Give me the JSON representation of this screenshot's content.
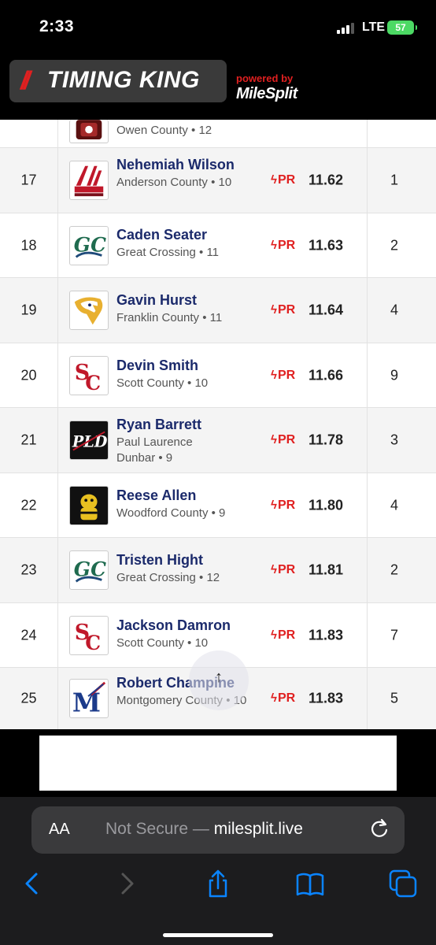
{
  "status_bar": {
    "time": "2:33",
    "network": "LTE",
    "battery": "57"
  },
  "header": {
    "logo_slashes": "//",
    "logo_text": "TIMING KING",
    "powered_by": "powered by",
    "partner": "MileSplit"
  },
  "partial_row": {
    "team_grade": "Owen County • 12"
  },
  "results": [
    {
      "place": "17",
      "name": "Nehemiah Wilson",
      "team_grade": "Anderson County • 10",
      "pr": "PR",
      "mark": "11.62",
      "heat": "1",
      "logo": "achs-track-field-logo"
    },
    {
      "place": "18",
      "name": "Caden Seater",
      "team_grade": "Great Crossing • 11",
      "pr": "PR",
      "mark": "11.63",
      "heat": "2",
      "logo": "great-crossing-logo"
    },
    {
      "place": "19",
      "name": "Gavin Hurst",
      "team_grade": "Franklin County • 11",
      "pr": "PR",
      "mark": "11.64",
      "heat": "4",
      "logo": "franklin-county-eagle-logo"
    },
    {
      "place": "20",
      "name": "Devin Smith",
      "team_grade": "Scott County • 10",
      "pr": "PR",
      "mark": "11.66",
      "heat": "9",
      "logo": "scott-county-logo"
    },
    {
      "place": "21",
      "name": "Ryan Barrett",
      "team_grade": "Paul Laurence Dunbar • 9",
      "pr": "PR",
      "mark": "11.78",
      "heat": "3",
      "logo": "pld-logo"
    },
    {
      "place": "22",
      "name": "Reese Allen",
      "team_grade": "Woodford County • 9",
      "pr": "PR",
      "mark": "11.80",
      "heat": "4",
      "logo": "woodford-county-jacket-logo"
    },
    {
      "place": "23",
      "name": "Tristen Hight",
      "team_grade": "Great Crossing • 12",
      "pr": "PR",
      "mark": "11.81",
      "heat": "2",
      "logo": "great-crossing-logo"
    },
    {
      "place": "24",
      "name": "Jackson Damron",
      "team_grade": "Scott County • 10",
      "pr": "PR",
      "mark": "11.83",
      "heat": "7",
      "logo": "scott-county-logo"
    },
    {
      "place": "25",
      "name": "Robert Champine",
      "team_grade": "Montgomery County • 10",
      "pr": "PR",
      "mark": "11.83",
      "heat": "5",
      "logo": "montgomery-county-logo"
    }
  ],
  "scroll_top_icon": "arrow-up-icon",
  "browser": {
    "aa_label": "AA",
    "url_prefix": "Not Secure —",
    "url": "milesplit.live",
    "icons": [
      "back-icon",
      "forward-icon",
      "share-icon",
      "bookmarks-icon",
      "tabs-icon",
      "reload-icon"
    ]
  },
  "colors": {
    "accent_red": "#e02020",
    "name_navy": "#1b2a6b",
    "safari_blue": "#0a84ff"
  }
}
